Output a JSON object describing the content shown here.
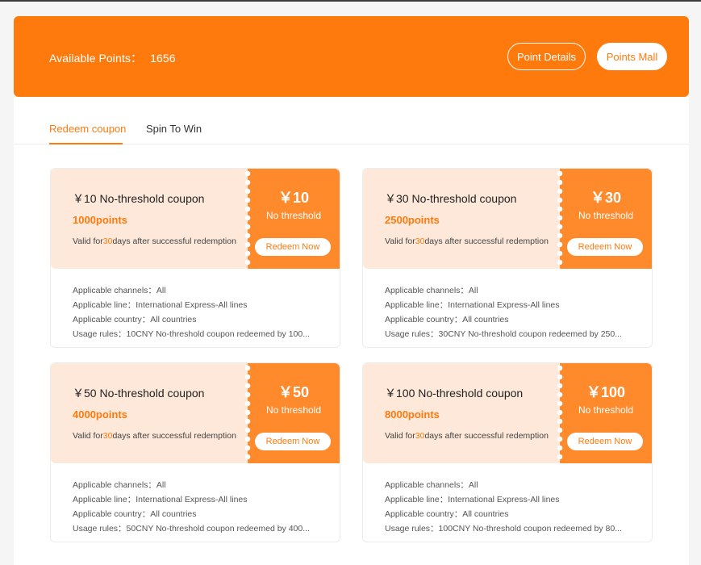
{
  "header": {
    "available_points_label": "Available Points：",
    "available_points_value": "1656",
    "point_details_button": "Point Details",
    "points_mall_button": "Points Mall"
  },
  "tabs": [
    {
      "label": "Redeem coupon",
      "active": true
    },
    {
      "label": "Spin To Win",
      "active": false
    }
  ],
  "coupons": [
    {
      "title": "￥10 No-threshold coupon",
      "points": "1000points",
      "valid_prefix": "Valid for",
      "valid_days": "30",
      "valid_suffix": "days after successful redemption",
      "amount": "￥10",
      "threshold": "No threshold",
      "redeem": "Redeem Now",
      "channels": "Applicable channels：All",
      "line": "Applicable line：International Express-All lines",
      "country": "Applicable country：All countries",
      "rules": "Usage rules：10CNY No-threshold coupon redeemed by 100..."
    },
    {
      "title": "￥30 No-threshold coupon",
      "points": "2500points",
      "valid_prefix": "Valid for",
      "valid_days": "30",
      "valid_suffix": "days after successful redemption",
      "amount": "￥30",
      "threshold": "No threshold",
      "redeem": "Redeem Now",
      "channels": "Applicable channels：All",
      "line": "Applicable line：International Express-All lines",
      "country": "Applicable country：All countries",
      "rules": "Usage rules：30CNY No-threshold coupon redeemed by 250..."
    },
    {
      "title": "￥50 No-threshold coupon",
      "points": "4000points",
      "valid_prefix": "Valid for",
      "valid_days": "30",
      "valid_suffix": "days after successful redemption",
      "amount": "￥50",
      "threshold": "No threshold",
      "redeem": "Redeem Now",
      "channels": "Applicable channels：All",
      "line": "Applicable line：International Express-All lines",
      "country": "Applicable country：All countries",
      "rules": "Usage rules：50CNY No-threshold coupon redeemed by 400..."
    },
    {
      "title": "￥100 No-threshold coupon",
      "points": "8000points",
      "valid_prefix": "Valid for",
      "valid_days": "30",
      "valid_suffix": "days after successful redemption",
      "amount": "￥100",
      "threshold": "No threshold",
      "redeem": "Redeem Now",
      "channels": "Applicable channels：All",
      "line": "Applicable line：International Express-All lines",
      "country": "Applicable country：All countries",
      "rules": "Usage rules：100CNY No-threshold coupon redeemed by 80..."
    }
  ],
  "colors": {
    "accent": "#ff7a0d",
    "ticket_light": "#fde8da",
    "ticket_dark": "#ff8a2c"
  }
}
